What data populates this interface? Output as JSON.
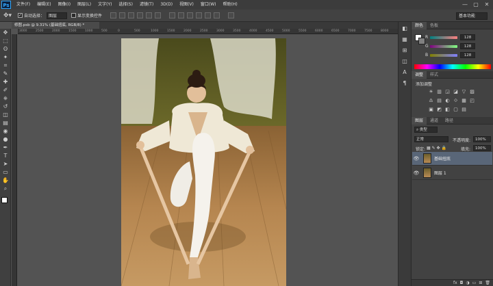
{
  "app": {
    "logo": "Ps",
    "menu": [
      "文件(F)",
      "编辑(E)",
      "图像(I)",
      "图层(L)",
      "文字(Y)",
      "选择(S)",
      "滤镜(T)",
      "3D(D)",
      "视图(V)",
      "窗口(W)",
      "帮助(H)"
    ],
    "window_controls": {
      "minimize": "—",
      "restore": "▢",
      "close": "✕"
    }
  },
  "options": {
    "auto_select_label": "自动选择：",
    "auto_select_value": "图层",
    "show_transform_label": "显示变换控件",
    "workspace": "基本功能"
  },
  "document": {
    "tab_title": "修图.psb @ 9.31% (基础扭底, RGB/8) *",
    "close": "×"
  },
  "ruler_ticks": [
    "3000",
    "2500",
    "2000",
    "1500",
    "1000",
    "500",
    "0",
    "500",
    "1000",
    "1500",
    "2000",
    "2500",
    "3000",
    "3500",
    "4000",
    "4500",
    "5000",
    "5500",
    "6000",
    "6500",
    "7000",
    "7500",
    "8000"
  ],
  "tools": [
    "move",
    "marquee",
    "lasso",
    "quick-select",
    "crop",
    "eyedropper",
    "healing",
    "brush",
    "clone-stamp",
    "history-brush",
    "eraser",
    "gradient",
    "blur",
    "dodge",
    "pen",
    "type",
    "path-select",
    "shape",
    "hand",
    "zoom"
  ],
  "tool_glyphs": [
    "✥",
    "⬚",
    "ʘ",
    "✦",
    "⌗",
    "✎",
    "✚",
    "✐",
    "⎈",
    "↺",
    "◫",
    "▤",
    "◉",
    "●",
    "✒",
    "T",
    "➤",
    "▭",
    "✋",
    "⌕"
  ],
  "color_panel": {
    "tabs": [
      "颜色",
      "色板"
    ],
    "sliders": [
      {
        "label": "R",
        "value": "128",
        "color": "#c04040"
      },
      {
        "label": "G",
        "value": "128",
        "color": "#40a040"
      },
      {
        "label": "B",
        "value": "128",
        "color": "#4060c0"
      }
    ]
  },
  "adjust_panel": {
    "tabs": [
      "调整",
      "样式"
    ],
    "title": "添加调整",
    "icons": [
      "☀",
      "▥",
      "◲",
      "◪",
      "▽",
      "▨",
      "♎",
      "▤",
      "◐",
      "⟐",
      "▦",
      "◰",
      "▣",
      "◩",
      "◧",
      "▢",
      "▤"
    ]
  },
  "layers_panel": {
    "tabs": [
      "图层",
      "通道",
      "路径"
    ],
    "filter": "类型",
    "blend_mode": "正常",
    "opacity_label": "不透明度:",
    "opacity": "100%",
    "lock_label": "锁定:",
    "fill_label": "填充:",
    "fill": "100%",
    "layers": [
      {
        "name": "基础扭底",
        "selected": true
      },
      {
        "name": "图层 1",
        "selected": false
      }
    ],
    "footer_icons": [
      "fx",
      "◘",
      "◑",
      "▭",
      "⊞",
      "🗑"
    ]
  },
  "dock_icons": [
    "◧",
    "▦",
    "⊞",
    "◫",
    "A",
    "¶"
  ],
  "colors": {
    "selection": "#596678",
    "accent": "#31a8ff"
  }
}
